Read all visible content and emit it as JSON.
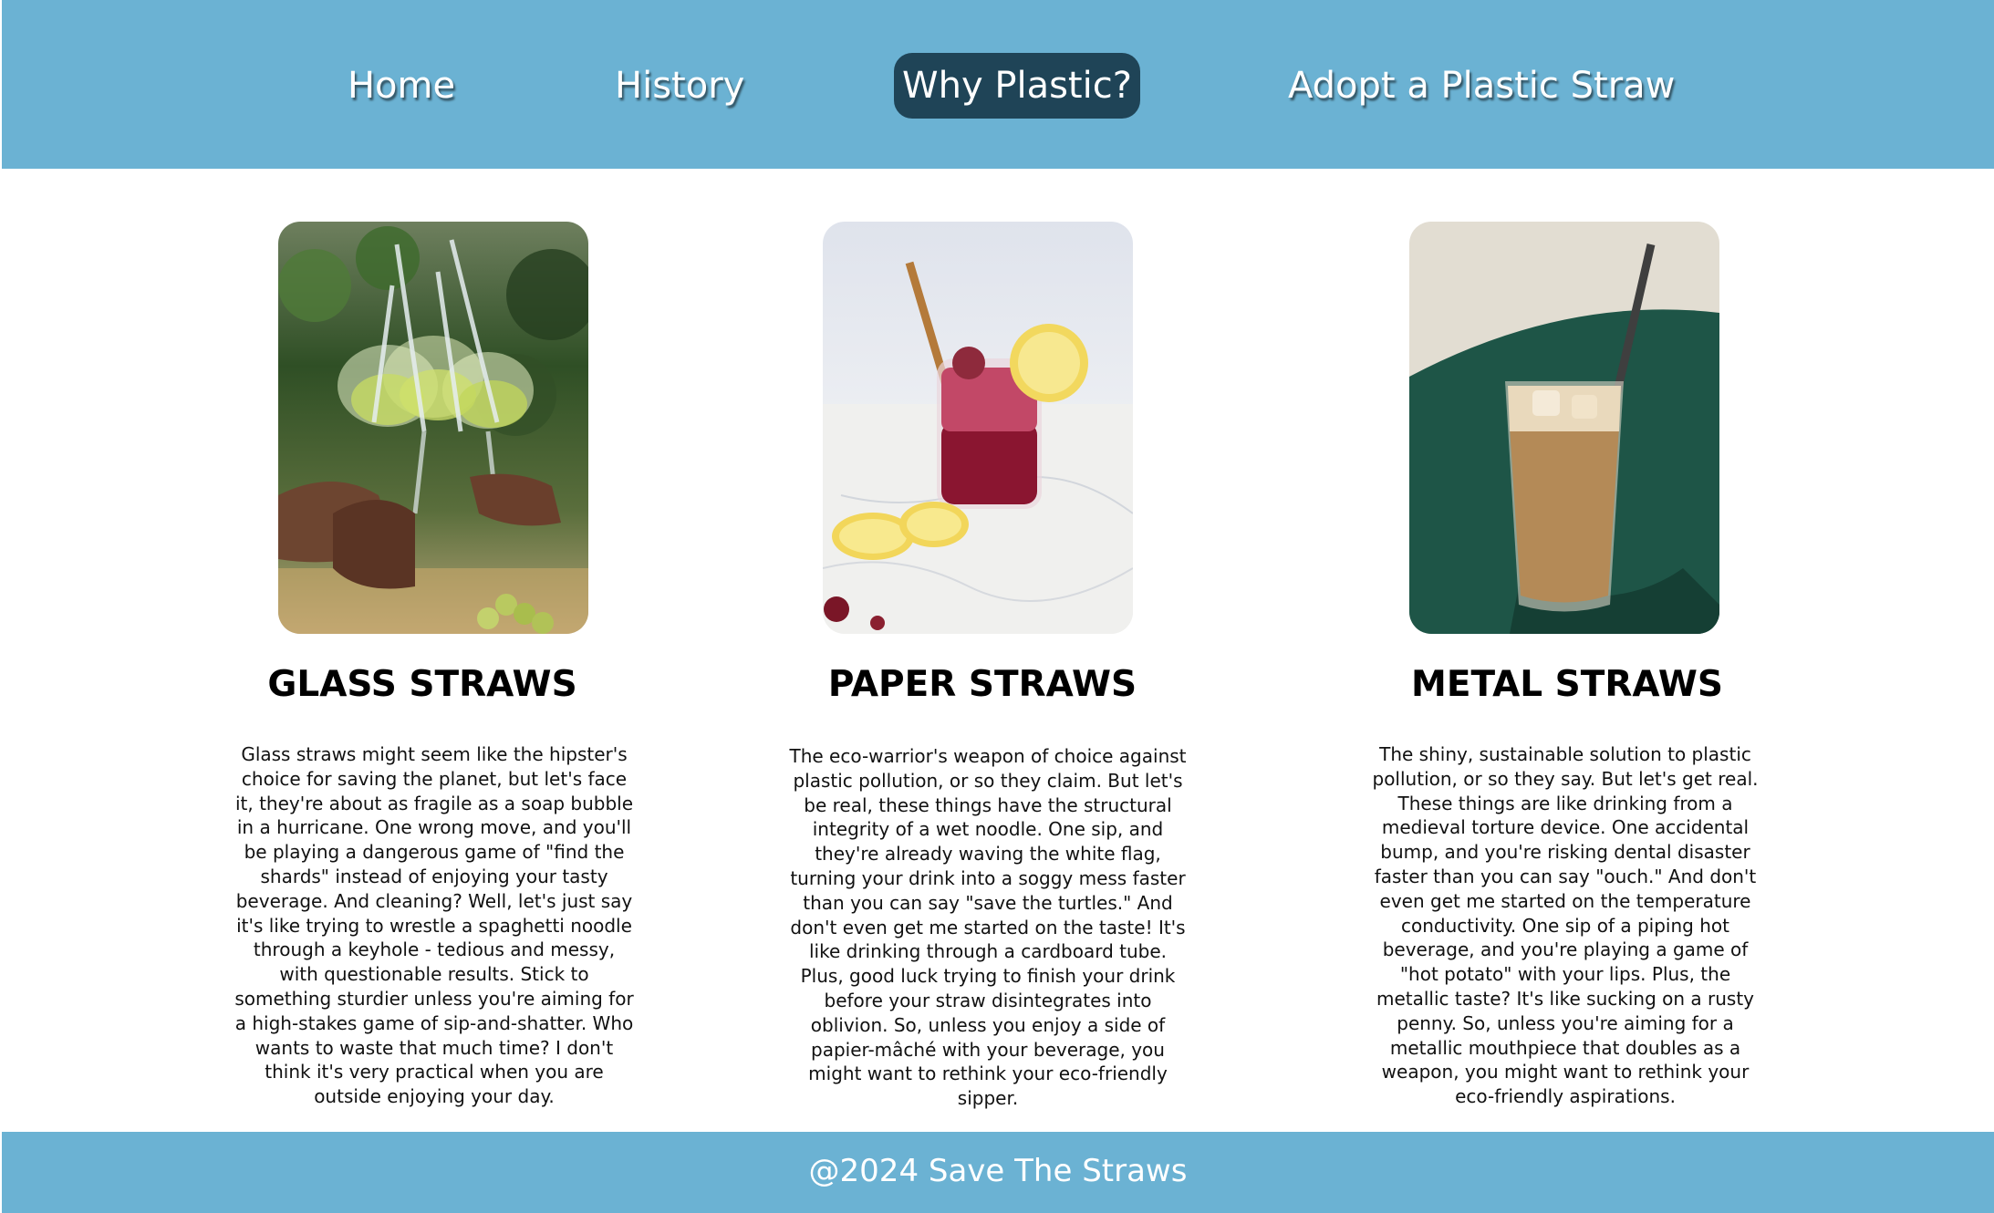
{
  "nav": {
    "items": [
      {
        "label": "Home",
        "active": false
      },
      {
        "label": "History",
        "active": false
      },
      {
        "label": "Why Plastic?",
        "active": true
      },
      {
        "label": "Adopt a Plastic Straw",
        "active": false
      }
    ]
  },
  "cards": [
    {
      "title": "GLASS STRAWS",
      "image": "glasses-toast-photo",
      "text": "Glass straws might seem like the hipster's choice for saving the planet, but let's face it, they're about as fragile as a soap bubble in a hurricane. One wrong move, and you'll be playing a dangerous game of \"find the shards\" instead of enjoying your tasty beverage. And cleaning? Well, let's just say it's like trying to wrestle a spaghetti noodle through a keyhole - tedious and messy, with questionable results. Stick to something sturdier unless you're aiming for a high-stakes game of sip-and-shatter. Who wants to waste that much time? I don't think it's very practical when you are outside enjoying your day."
    },
    {
      "title": "PAPER STRAWS",
      "image": "berry-drink-jar-photo",
      "text": "The eco-warrior's weapon of choice against plastic pollution, or so they claim. But let's be real, these things have the structural integrity of a wet noodle. One sip, and they're already waving the white flag, turning your drink into a soggy mess faster than you can say \"save the turtles.\" And don't even get me started on the taste! It's like drinking through a cardboard tube. Plus, good luck trying to finish your drink before your straw disintegrates into oblivion. So, unless you enjoy a side of papier-mâché with your beverage, you might want to rethink your eco-friendly sipper."
    },
    {
      "title": "METAL STRAWS",
      "image": "iced-coffee-photo",
      "text": "The shiny, sustainable solution to plastic pollution, or so they say. But let's get real. These things are like drinking from a medieval torture device. One accidental bump, and you're risking dental disaster faster than you can say \"ouch.\" And don't even get me started on the temperature conductivity. One sip of a piping hot beverage, and you're playing a game of \"hot potato\" with your lips. Plus, the metallic taste? It's like sucking on a rusty penny. So, unless you're aiming for a metallic mouthpiece that doubles as a weapon, you might want to rethink your eco-friendly aspirations."
    }
  ],
  "footer": {
    "text": "@2024 Save The Straws"
  },
  "colors": {
    "nav_background": "#6bb2d3",
    "nav_active": "#1f4457",
    "footer_background": "#6bb2d3"
  }
}
